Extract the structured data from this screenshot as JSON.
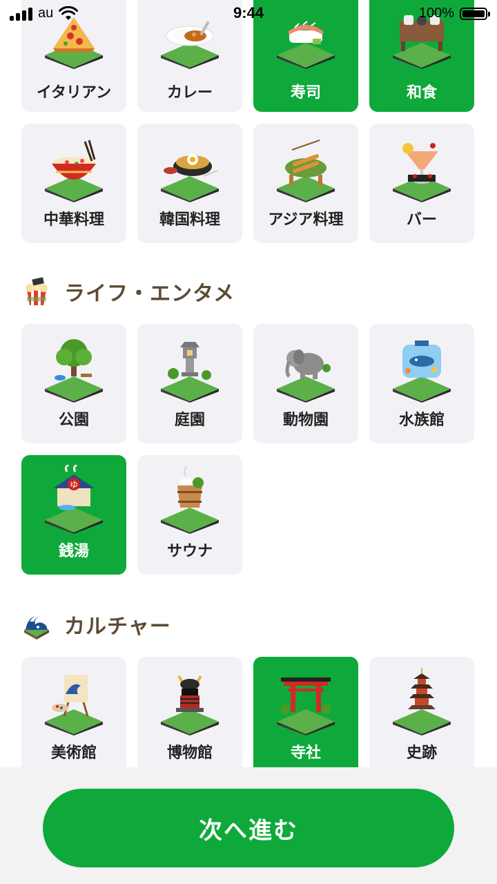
{
  "status_bar": {
    "carrier": "au",
    "time": "9:44",
    "battery": "100%",
    "battery_level": 1.0
  },
  "food_top_row": [
    {
      "label": "イタリアン",
      "icon": "pizza-icon",
      "selected": false
    },
    {
      "label": "カレー",
      "icon": "curry-icon",
      "selected": false
    },
    {
      "label": "寿司",
      "icon": "sushi-icon",
      "selected": true
    },
    {
      "label": "和食",
      "icon": "japanese-food-icon",
      "selected": true
    }
  ],
  "food_second_row": [
    {
      "label": "中華料理",
      "icon": "chinese-food-icon",
      "selected": false
    },
    {
      "label": "韓国料理",
      "icon": "bibimbap-icon",
      "selected": false
    },
    {
      "label": "アジア料理",
      "icon": "asian-food-icon",
      "selected": false
    },
    {
      "label": "バー",
      "icon": "cocktail-icon",
      "selected": false
    }
  ],
  "life_section": {
    "title": "ライフ・エンタメ",
    "icon": "popcorn-icon",
    "items": [
      {
        "label": "公園",
        "icon": "park-tree-icon",
        "selected": false
      },
      {
        "label": "庭園",
        "icon": "stone-lantern-icon",
        "selected": false
      },
      {
        "label": "動物園",
        "icon": "elephant-icon",
        "selected": false
      },
      {
        "label": "水族館",
        "icon": "aquarium-icon",
        "selected": false
      },
      {
        "label": "銭湯",
        "icon": "bathhouse-icon",
        "selected": true
      },
      {
        "label": "サウナ",
        "icon": "sauna-bucket-icon",
        "selected": false
      }
    ]
  },
  "culture_section": {
    "title": "カルチャー",
    "icon": "great-wave-icon",
    "items": [
      {
        "label": "美術館",
        "icon": "easel-painting-icon",
        "selected": false
      },
      {
        "label": "博物館",
        "icon": "samurai-armor-icon",
        "selected": false
      },
      {
        "label": "寺社",
        "icon": "torii-gate-icon",
        "selected": true
      },
      {
        "label": "史跡",
        "icon": "pagoda-icon",
        "selected": false
      }
    ]
  },
  "next_button": {
    "label": "次へ進む"
  },
  "colors": {
    "accent_green": "#0fa93b",
    "card_bg": "#f2f2f6",
    "section_title": "#5c4a32"
  }
}
